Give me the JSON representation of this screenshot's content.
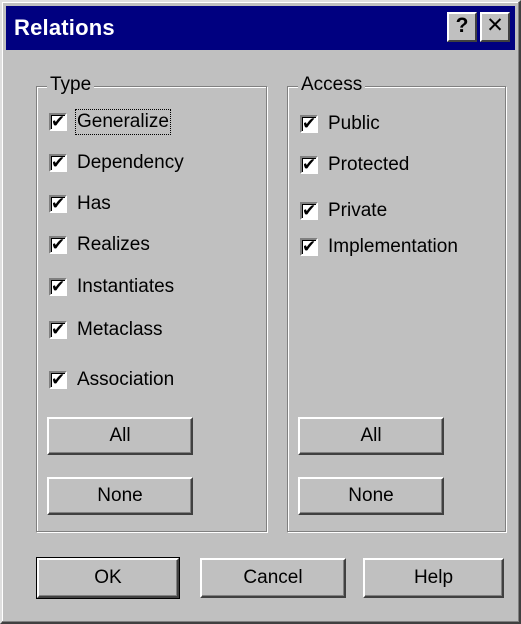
{
  "window": {
    "title": "Relations",
    "help_glyph": "?",
    "close_glyph": "✕"
  },
  "type_group": {
    "label": "Type",
    "items": [
      {
        "label": "Generalize",
        "checked": true
      },
      {
        "label": "Dependency",
        "checked": true
      },
      {
        "label": "Has",
        "checked": true
      },
      {
        "label": "Realizes",
        "checked": true
      },
      {
        "label": "Instantiates",
        "checked": true
      },
      {
        "label": "Metaclass",
        "checked": true
      },
      {
        "label": "Association",
        "checked": true
      }
    ],
    "all_label": "All",
    "none_label": "None"
  },
  "access_group": {
    "label": "Access",
    "items": [
      {
        "label": "Public",
        "checked": true
      },
      {
        "label": "Protected",
        "checked": true
      },
      {
        "label": "Private",
        "checked": true
      },
      {
        "label": "Implementation",
        "checked": true
      }
    ],
    "all_label": "All",
    "none_label": "None"
  },
  "footer": {
    "ok_label": "OK",
    "cancel_label": "Cancel",
    "help_label": "Help"
  },
  "check_glyph": "✔"
}
